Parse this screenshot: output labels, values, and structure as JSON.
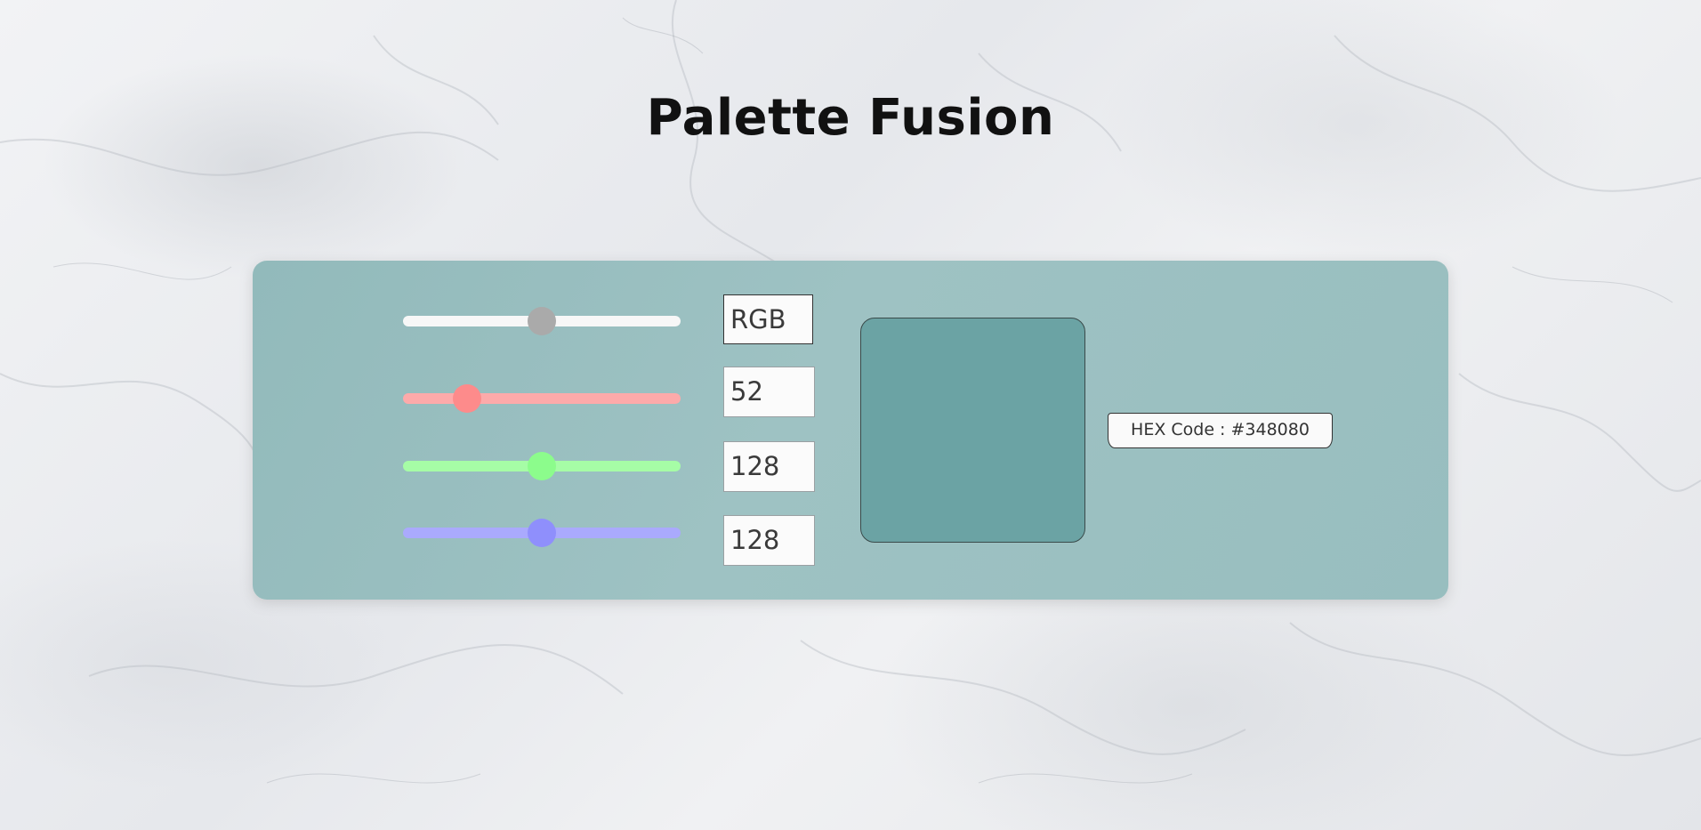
{
  "app": {
    "title": "Palette Fusion"
  },
  "colors": {
    "background": "#eceef1",
    "panel": "#9ec2c3",
    "preview": "#348080",
    "master_track": "#f7f7f7",
    "master_thumb": "#aaaaaa",
    "red_track": "#fdaaaa",
    "red_thumb": "#fd8b8b",
    "green_track": "#a6fda6",
    "green_thumb": "#8cfc8c",
    "blue_track": "#aaaafd",
    "blue_thumb": "#8f8ffc"
  },
  "mixer": {
    "mode": "RGB",
    "red": "52",
    "green": "128",
    "blue": "128",
    "hex_label": "HEX Code : #348080"
  },
  "sliders": {
    "master_level": 0.5,
    "red_level": 52,
    "green_level": 128,
    "blue_level": 128,
    "max": 255
  },
  "icons": {
    "slider_thumb": "circle-thumb"
  }
}
